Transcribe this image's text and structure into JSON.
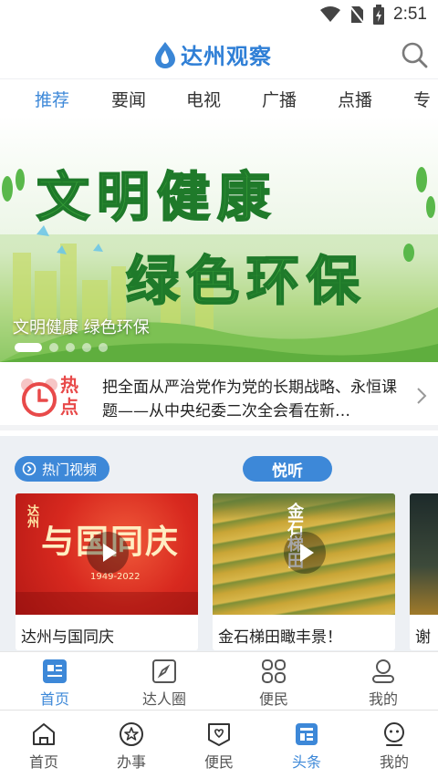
{
  "status_bar": {
    "time": "2:51"
  },
  "header": {
    "app_title": "达州观察"
  },
  "tabs": [
    "推荐",
    "要闻",
    "电视",
    "广播",
    "点播",
    "专"
  ],
  "banner": {
    "line1": "文明健康",
    "line2": "绿色环保",
    "caption": "文明健康 绿色环保",
    "dot_count": 5,
    "active_dot": 0
  },
  "hot": {
    "label": "热点",
    "text": "把全面从严治党作为党的长期战略、永恒课题——从中央纪委二次全会看在新…"
  },
  "videos": {
    "hot_label": "热门视频",
    "yue_label": "悦听",
    "cards": [
      {
        "title": "达州与国同庆",
        "overlay_top": "达州",
        "overlay_main": "与国同庆",
        "years": "1949-2022"
      },
      {
        "title": "金石梯田瞰丰景！",
        "overlay_main": "金石梯田"
      },
      {
        "title": "谢"
      }
    ]
  },
  "inner_nav": [
    {
      "label": "首页",
      "icon": "news-list-icon",
      "active": true
    },
    {
      "label": "达人圈",
      "icon": "compass-icon",
      "active": false
    },
    {
      "label": "便民",
      "icon": "grid-icon",
      "active": false
    },
    {
      "label": "我的",
      "icon": "person-icon",
      "active": false
    }
  ],
  "bottom_nav": [
    {
      "label": "首页",
      "icon": "home-icon",
      "active": false
    },
    {
      "label": "办事",
      "icon": "star-icon",
      "active": false
    },
    {
      "label": "便民",
      "icon": "heart-badge-icon",
      "active": false
    },
    {
      "label": "头条",
      "icon": "headline-icon",
      "active": true
    },
    {
      "label": "我的",
      "icon": "face-icon",
      "active": false
    }
  ],
  "colors": {
    "accent": "#3d88d8",
    "hot_red": "#e84a4a",
    "banner_green": "#3aa53a"
  }
}
